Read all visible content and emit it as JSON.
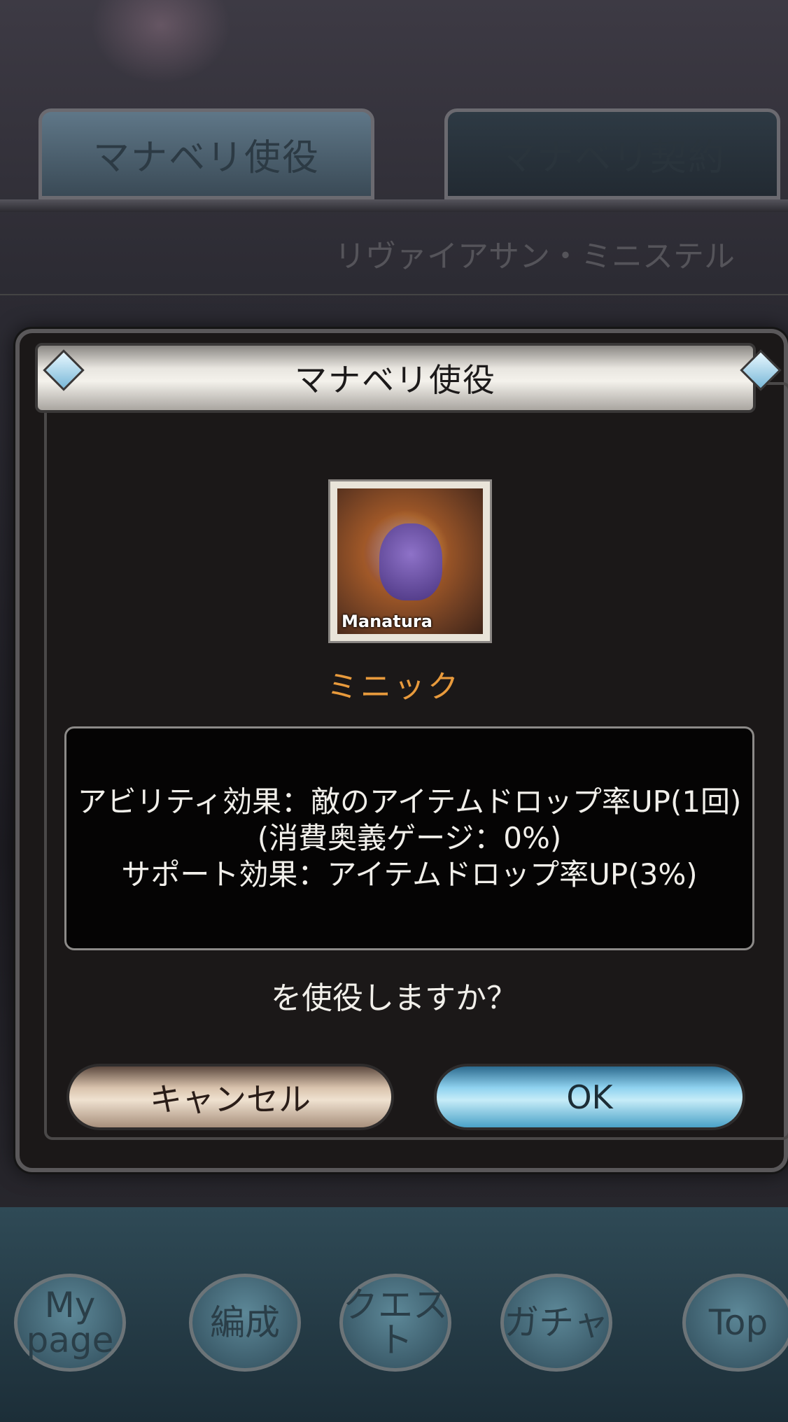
{
  "background": {
    "tabs": [
      "マナベリ使役",
      "マナベリ契約"
    ],
    "subtitle": "リヴァイアサン・ミニステル",
    "nav": [
      "My page",
      "編成",
      "クエスト",
      "ガチャ",
      "Top"
    ]
  },
  "dialog": {
    "title": "マナベリ使役",
    "portrait_label": "Manatura",
    "character_name": "ミニック",
    "description": {
      "line1": "アビリティ効果：敵のアイテムドロップ率UP(1回)",
      "line2": "(消費奥義ゲージ：0%)",
      "line3": "サポート効果：アイテムドロップ率UP(3%)"
    },
    "question": "を使役しますか？",
    "cancel_label": "キャンセル",
    "ok_label": "OK"
  },
  "colors": {
    "accent_name": "#e89a3c",
    "ok_button": "#8fd2ef",
    "cancel_button": "#d9c3ad"
  }
}
